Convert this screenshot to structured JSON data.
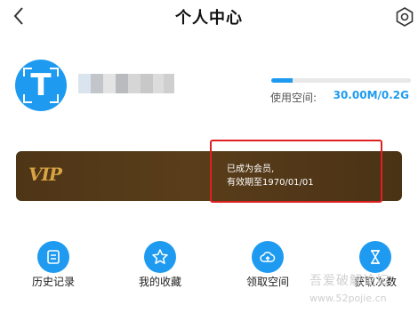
{
  "header": {
    "title": "个人中心"
  },
  "profile": {
    "avatar_letter": "T"
  },
  "storage": {
    "label": "使用空间:",
    "value": "30.00M/0.2G",
    "used_fraction": 0.15
  },
  "vip": {
    "logo": "VIP",
    "status_line1": "已成为会员,",
    "status_line2": "有效期至1970/01/01"
  },
  "features": [
    {
      "label": "历史记录",
      "icon": "history-list-icon"
    },
    {
      "label": "我的收藏",
      "icon": "favorite-star-icon"
    },
    {
      "label": "领取空间",
      "icon": "cloud-upload-icon"
    },
    {
      "label": "获取次数",
      "icon": "hourglass-icon"
    }
  ],
  "watermark": {
    "line1": "吾爱破解论坛",
    "line2": "www.52pojie.cn"
  },
  "colors": {
    "accent": "#1e9bf0",
    "vip_bg": "#4e3516",
    "vip_gold": "#d9a443",
    "highlight": "#e02020"
  }
}
